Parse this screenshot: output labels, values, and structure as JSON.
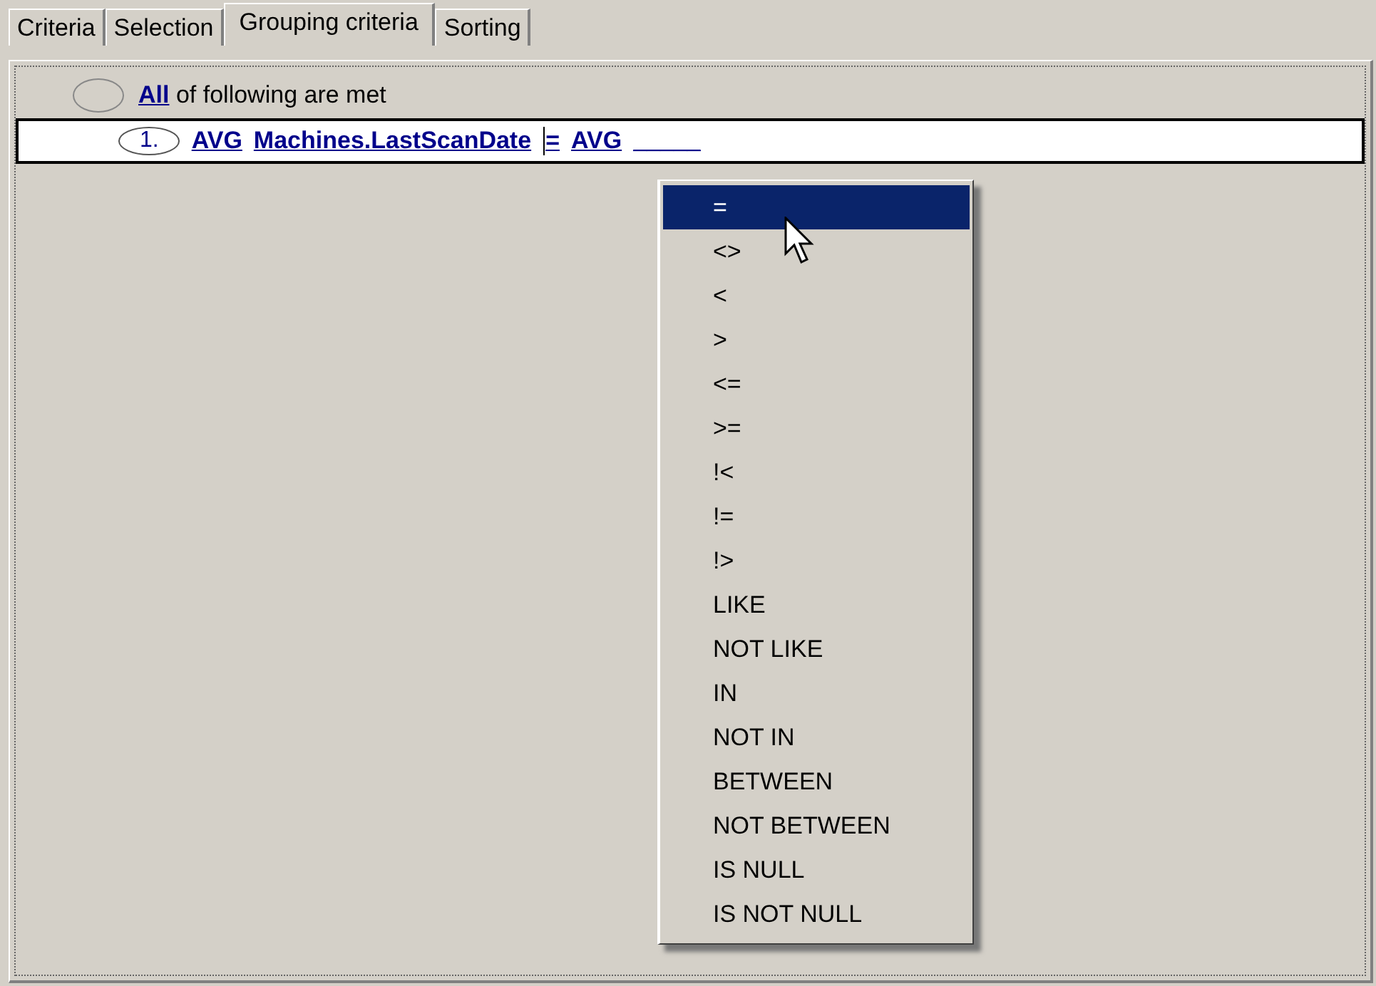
{
  "tabs": [
    {
      "label": "Criteria",
      "selected": false
    },
    {
      "label": "Selection",
      "selected": false
    },
    {
      "label": "Grouping criteria",
      "selected": true
    },
    {
      "label": "Sorting",
      "selected": false
    }
  ],
  "group": {
    "quantifier": "All",
    "text": "of following are met"
  },
  "conditions": [
    {
      "number": "1.",
      "aggregate": "AVG",
      "field": "Machines.LastScanDate",
      "operator": "=",
      "value_aggregate": "AVG",
      "value": "_____"
    }
  ],
  "operator_menu": {
    "items": [
      {
        "label": "=",
        "selected": true
      },
      {
        "label": "<>",
        "selected": false
      },
      {
        "label": "<",
        "selected": false
      },
      {
        "label": ">",
        "selected": false
      },
      {
        "label": "<=",
        "selected": false
      },
      {
        "label": ">=",
        "selected": false
      },
      {
        "label": "!<",
        "selected": false
      },
      {
        "label": "!=",
        "selected": false
      },
      {
        "label": "!>",
        "selected": false
      },
      {
        "label": "LIKE",
        "selected": false
      },
      {
        "label": "NOT LIKE",
        "selected": false
      },
      {
        "label": "IN",
        "selected": false
      },
      {
        "label": "NOT IN",
        "selected": false
      },
      {
        "label": "BETWEEN",
        "selected": false
      },
      {
        "label": "NOT BETWEEN",
        "selected": false
      },
      {
        "label": "IS NULL",
        "selected": false
      },
      {
        "label": "IS NOT NULL",
        "selected": false
      }
    ]
  }
}
